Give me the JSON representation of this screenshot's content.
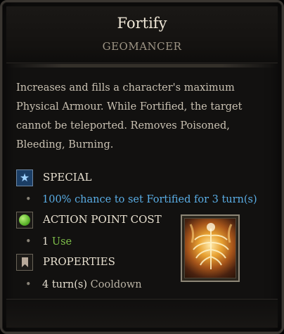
{
  "skill": {
    "name": "Fortify",
    "school": "GEOMANCER",
    "description": "Increases and fills a character's maximum Physical Armour. While Fortified, the target cannot be teleported. Removes Poisoned, Bleeding, Burning.",
    "icon": "fortify-skill-icon"
  },
  "sections": {
    "special": {
      "label": "SPECIAL",
      "icon": "star-icon",
      "bullet": "100% chance to set Fortified for 3 turn(s)"
    },
    "ap_cost": {
      "label": "ACTION POINT COST",
      "icon": "green-dot-icon",
      "value": "1",
      "unit": "Use"
    },
    "properties": {
      "label": "PROPERTIES",
      "icon": "bookmark-icon",
      "value": "4 turn(s)",
      "unit": "Cooldown"
    }
  },
  "colors": {
    "background": "#121110",
    "special_text": "#5aaee6",
    "ap_unit": "#7fc04a"
  }
}
